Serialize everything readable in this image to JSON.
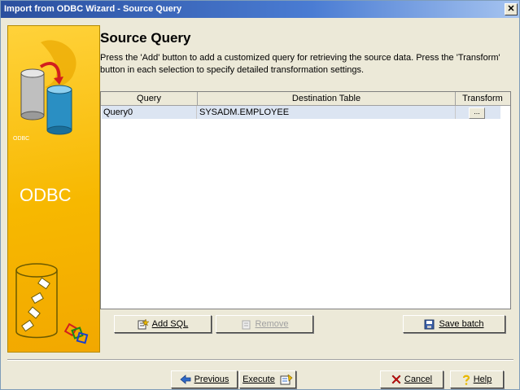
{
  "window": {
    "title": "Import from ODBC Wizard - Source Query",
    "close_glyph": "✕"
  },
  "sidebar": {
    "odbc_label": "ODBC",
    "small_label": "ODBC",
    "logo_icon": "database-logo",
    "lower_icon": "cylinder-chain"
  },
  "page": {
    "heading": "Source Query",
    "description": "Press the 'Add' button to add a customized query for retrieving the source data. Press the 'Transform' button in each selection to specify detailed transformation settings."
  },
  "table": {
    "columns": [
      "Query",
      "Destination Table",
      "Transform"
    ],
    "rows": [
      {
        "query": "Query0",
        "destination": "SYSADM.EMPLOYEE",
        "transform_btn": "..."
      }
    ]
  },
  "buttons": {
    "add_sql": "Add SQL",
    "remove": "Remove",
    "save_batch": "Save batch",
    "previous": "Previous",
    "execute": "Execute",
    "cancel": "Cancel",
    "help": "Help"
  },
  "colors": {
    "sidebar_yellow": "#f7b800",
    "selected_row": "#dce5f2",
    "titlebar": "#2a4f9e"
  }
}
